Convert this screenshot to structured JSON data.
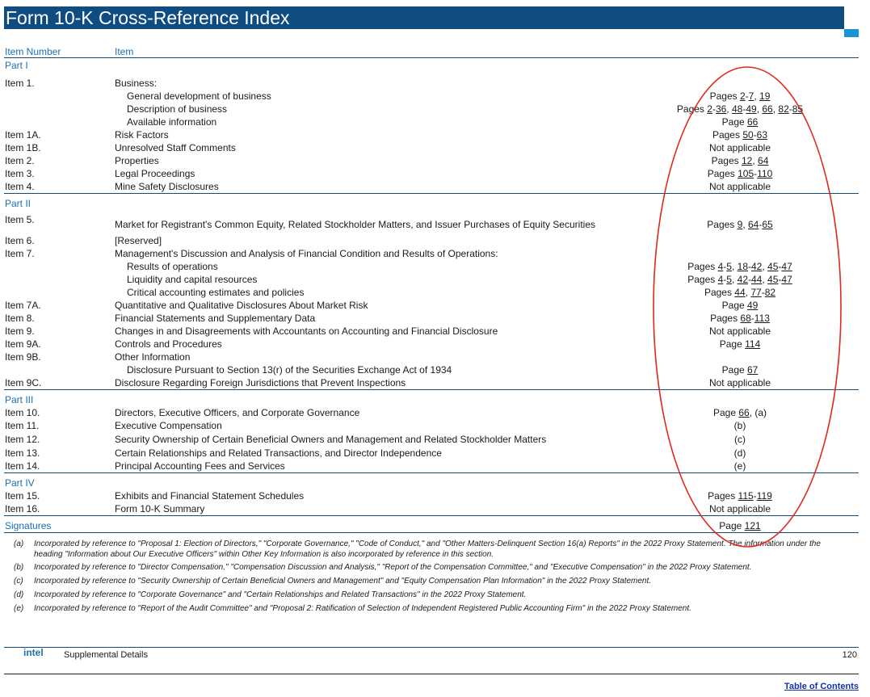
{
  "header": {
    "title": "Form 10-K Cross-Reference Index"
  },
  "columns": {
    "item_number": "Item Number",
    "item": "Item"
  },
  "parts": {
    "p1": "Part I",
    "p2": "Part II",
    "p3": "Part III",
    "p4": "Part IV",
    "sig": "Signatures"
  },
  "rows": [
    {
      "num": "Item 1.",
      "desc": "Business:",
      "pg": []
    },
    {
      "num": "",
      "desc": "General development of business",
      "pg": [
        "Pages ",
        {
          "l": "2"
        },
        "-",
        {
          "l": "7"
        },
        ", ",
        {
          "l": "19"
        }
      ]
    },
    {
      "num": "",
      "desc": "Description of business",
      "pg": [
        "Pages ",
        {
          "l": "2"
        },
        "-",
        {
          "l": "36"
        },
        ", ",
        {
          "l": "48"
        },
        "-",
        {
          "l": "49"
        },
        ", ",
        {
          "l": "66"
        },
        ", ",
        {
          "l": "82"
        },
        "-",
        {
          "l": "85"
        }
      ]
    },
    {
      "num": "",
      "desc": "Available information",
      "pg": [
        "Page ",
        {
          "l": "66"
        }
      ]
    },
    {
      "num": "Item 1A.",
      "desc": "Risk Factors",
      "pg": [
        "Pages ",
        {
          "l": "50"
        },
        "-",
        {
          "l": "63"
        }
      ]
    },
    {
      "num": "Item 1B.",
      "desc": "Unresolved Staff Comments",
      "pg": [
        "Not applicable"
      ]
    },
    {
      "num": "Item 2.",
      "desc": "Properties",
      "pg": [
        "Pages ",
        {
          "l": "12"
        },
        ", ",
        {
          "l": "64"
        }
      ]
    },
    {
      "num": "Item 3.",
      "desc": "Legal Proceedings",
      "pg": [
        "Pages ",
        {
          "l": "105"
        },
        "-",
        {
          "l": "110"
        }
      ]
    },
    {
      "num": "Item 4.",
      "desc": "Mine Safety Disclosures",
      "pg": [
        "Not applicable"
      ]
    },
    {
      "num": "Item 5.",
      "desc": "Market for Registrant's Common Equity, Related Stockholder Matters, and Issuer Purchases of Equity Securities",
      "pg": [
        "Pages ",
        {
          "l": "9"
        },
        ", ",
        {
          "l": "64"
        },
        "-",
        {
          "l": "65"
        }
      ]
    },
    {
      "num": "Item 6.",
      "desc": "[Reserved]",
      "pg": []
    },
    {
      "num": "Item 7.",
      "desc": "Management's Discussion and Analysis of Financial Condition and Results of Operations:",
      "pg": []
    },
    {
      "num": "",
      "desc": "Results of operations",
      "pg": [
        "Pages ",
        {
          "l": "4"
        },
        "-",
        {
          "l": "5"
        },
        ", ",
        {
          "l": "18"
        },
        "-",
        {
          "l": "42"
        },
        ", ",
        {
          "l": "45"
        },
        "-",
        {
          "l": "47"
        }
      ]
    },
    {
      "num": "",
      "desc": "Liquidity and capital resources",
      "pg": [
        "Pages ",
        {
          "l": "4"
        },
        "-",
        {
          "l": "5"
        },
        ", ",
        {
          "l": "42"
        },
        "-",
        {
          "l": "44"
        },
        ", ",
        {
          "l": "45"
        },
        "-",
        {
          "l": "47"
        }
      ]
    },
    {
      "num": "",
      "desc": "Critical accounting estimates and policies",
      "pg": [
        "Pages ",
        {
          "l": "44"
        },
        ", ",
        {
          "l": "77"
        },
        "-",
        {
          "l": "82"
        }
      ]
    },
    {
      "num": "Item 7A.",
      "desc": "Quantitative and Qualitative Disclosures About Market Risk",
      "pg": [
        "Page ",
        {
          "l": "49"
        }
      ]
    },
    {
      "num": "Item 8.",
      "desc": "Financial Statements and Supplementary Data",
      "pg": [
        "Pages ",
        {
          "l": "68"
        },
        "-",
        {
          "l": "113"
        }
      ]
    },
    {
      "num": "Item 9.",
      "desc": "Changes in and Disagreements with Accountants on Accounting and Financial Disclosure",
      "pg": [
        "Not applicable"
      ]
    },
    {
      "num": "Item 9A.",
      "desc": "Controls and Procedures",
      "pg": [
        "Page ",
        {
          "l": "114"
        }
      ]
    },
    {
      "num": "Item 9B.",
      "desc": "Other Information",
      "pg": []
    },
    {
      "num": "",
      "desc": "Disclosure Pursuant to Section 13(r) of the Securities Exchange Act of 1934",
      "pg": [
        "Page ",
        {
          "l": "67"
        }
      ]
    },
    {
      "num": "Item 9C.",
      "desc": "Disclosure Regarding Foreign Jurisdictions that Prevent Inspections",
      "pg": [
        "Not applicable"
      ]
    },
    {
      "num": "Item 10.",
      "desc": "Directors, Executive Officers, and Corporate Governance",
      "pg": [
        "Page ",
        {
          "l": "66"
        },
        ", (a)"
      ]
    },
    {
      "num": "Item 11.",
      "desc": "Executive Compensation",
      "pg": [
        "(b)"
      ]
    },
    {
      "num": "Item 12.",
      "desc": "Security Ownership of Certain Beneficial Owners and Management and Related Stockholder Matters",
      "pg": [
        "(c)"
      ]
    },
    {
      "num": "Item 13.",
      "desc": "Certain Relationships and Related Transactions, and Director Independence",
      "pg": [
        "(d)"
      ]
    },
    {
      "num": "Item 14.",
      "desc": "Principal Accounting Fees and Services",
      "pg": [
        "(e)"
      ]
    },
    {
      "num": "Item 15.",
      "desc": "Exhibits and Financial Statement Schedules",
      "pg": [
        "Pages ",
        {
          "l": "115"
        },
        "-",
        {
          "l": "119"
        }
      ]
    },
    {
      "num": "Item 16.",
      "desc": "Form 10-K Summary",
      "pg": [
        "Not applicable"
      ]
    },
    {
      "num": "",
      "desc": "",
      "pg": [
        "Page ",
        {
          "l": "121"
        }
      ]
    }
  ],
  "footnotes": [
    {
      "label": "(a)",
      "text": "Incorporated by reference to \"Proposal 1: Election of Directors,\" \"Corporate Governance,\" \"Code of Conduct,\" and \"Other Matters-Delinquent Section 16(a) Reports\" in the 2022 Proxy Statement. The information under the heading \"Information about Our Executive Officers\" within Other Key Information is also incorporated by reference in this section."
    },
    {
      "label": "(b)",
      "text": "Incorporated by reference to \"Director Compensation,\" \"Compensation Discussion and Analysis,\" \"Report of the Compensation Committee,\" and \"Executive Compensation\" in the 2022 Proxy Statement."
    },
    {
      "label": "(c)",
      "text": "Incorporated by reference to \"Security Ownership of Certain Beneficial Owners and Management\" and \"Equity Compensation Plan Information\" in the 2022 Proxy Statement."
    },
    {
      "label": "(d)",
      "text": "Incorporated by reference to \"Corporate Governance\" and \"Certain Relationships and Related Transactions\" in the 2022 Proxy Statement."
    },
    {
      "label": "(e)",
      "text": "Incorporated by reference to \"Report of the Audit Committee\" and \"Proposal 2: Ratification of Selection of Independent Registered Public Accounting Firm\" in the 2022 Proxy Statement."
    }
  ],
  "footer": {
    "logo": "intel",
    "section": "Supplemental Details",
    "page_number": "120",
    "toc_link": "Table of Contents"
  },
  "colors": {
    "brand_blue": "#0f4c81",
    "accent_blue": "#1993d8",
    "annotation_red": "#e0281e"
  },
  "annotation": {
    "shape": "hand-drawn ellipse",
    "color": "red"
  }
}
